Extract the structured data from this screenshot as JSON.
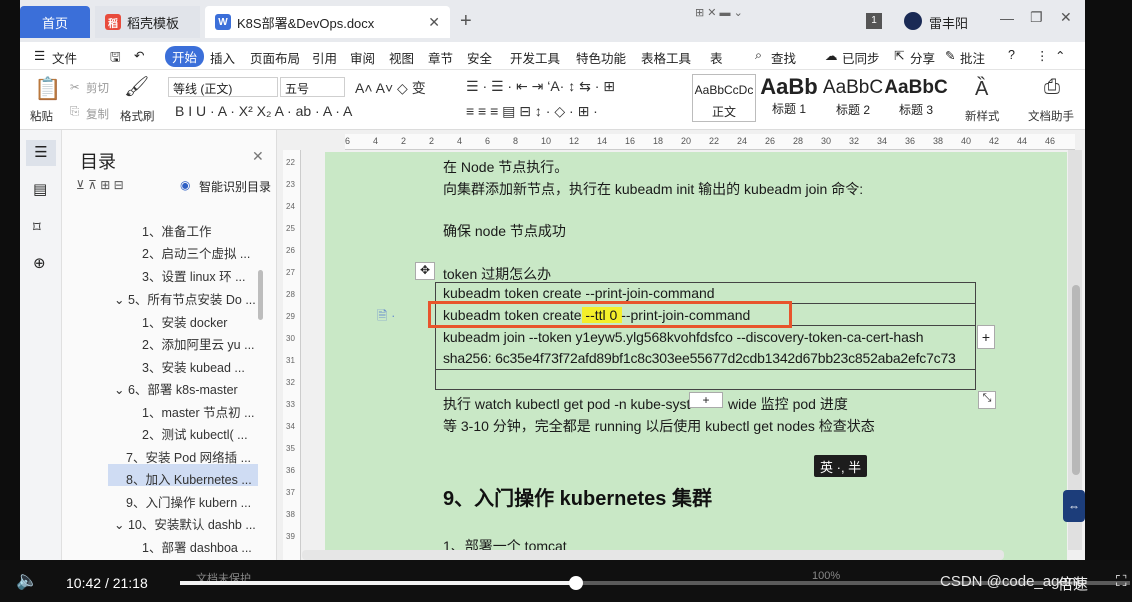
{
  "tabs": {
    "home": "首页",
    "template": "稻壳模板",
    "doc": "K8S部署&DevOps.docx",
    "new_tab": "+",
    "close": "✕"
  },
  "window": {
    "badge": "1",
    "user": "雷丰阳"
  },
  "menu": {
    "file": "文件",
    "start": "开始",
    "insert": "插入",
    "layout": "页面布局",
    "reference": "引用",
    "review": "审阅",
    "view": "视图",
    "chapter": "章节",
    "security": "安全",
    "devtools": "开发工具",
    "special": "特色功能",
    "table_tools": "表格工具",
    "table_style": "表",
    "search": "查找",
    "sync": "已同步",
    "share": "分享",
    "comment": "批注"
  },
  "ribbon": {
    "paste": "粘贴",
    "cut": "剪切",
    "copy": "复制",
    "format_painter": "格式刷",
    "font": "等线 (正文)",
    "size": "五号",
    "styles": [
      {
        "preview": "AaBbCcDc",
        "name": "正文"
      },
      {
        "preview": "AaBb",
        "name": "标题 1"
      },
      {
        "preview": "AaBbC",
        "name": "标题 2"
      },
      {
        "preview": "AaBbC",
        "name": "标题 3"
      }
    ],
    "new_style": "新样式",
    "doc_helper": "文档助手"
  },
  "toc": {
    "title": "目录",
    "smart": "智能识别目录",
    "items": [
      "1、准备工作",
      "2、启动三个虚拟 ...",
      "3、设置 linux 环 ...",
      "5、所有节点安装 Do ...",
      "1、安装 docker",
      "2、添加阿里云 yu ...",
      "3、安装 kubead ...",
      "6、部署 k8s-master",
      "1、master 节点初 ...",
      "2、测试 kubectl( ...",
      "7、安装 Pod 网络插 ...",
      "8、加入 Kubernetes ...",
      "9、入门操作 kubern ...",
      "10、安装默认 dashb ...",
      "1、部署 dashboa ..."
    ]
  },
  "ruler": [
    "6",
    "4",
    "2",
    "2",
    "4",
    "6",
    "8",
    "10",
    "12",
    "14",
    "16",
    "18",
    "20",
    "22",
    "24",
    "26",
    "28",
    "30",
    "32",
    "34",
    "36",
    "38",
    "40",
    "42",
    "44",
    "46"
  ],
  "vruler": [
    "22",
    "23",
    "24",
    "25",
    "26",
    "27",
    "28",
    "29",
    "30",
    "31",
    "32",
    "33",
    "34",
    "35",
    "36",
    "37",
    "38",
    "39"
  ],
  "doc": {
    "line1": "在 Node 节点执行。",
    "line2": "向集群添加新节点，执行在 kubeadm init 输出的 kubeadm join 命令:",
    "line3": "确保 node 节点成功",
    "line4": "token 过期怎么办",
    "cmd1": "kubeadm token create --print-join-command",
    "cmd2": "kubeadm token create --ttl 0 --print-join-command",
    "cmd3": "kubeadm    join    --token    y1eyw5.ylg568kvohfdsfco    --discovery-token-ca-cert-hash",
    "cmd4": "sha256: 6c35e4f73f72afd89bf1c8c303ee55677d2cdb1342d67bb23c852aba2efc7c73",
    "line5a": "执行 watch kubectl get pod -n kube-syst",
    "line5b": "wide 监控 pod 进度",
    "line6": "等 3-10 分钟，完全都是 running 以后使用 kubectl get nodes 检查状态",
    "ime": "英 ·, 半",
    "heading": "9、入门操作 kubernetes 集群",
    "sub": "1、部署一个 tomcat"
  },
  "player": {
    "current": "10:42",
    "sep": "/",
    "total": "21:18",
    "progress": 0.503,
    "watermark": "CSDN @code_agent",
    "speed": "倍速",
    "zoom": "100%",
    "bottom_left": "文档未保护"
  }
}
